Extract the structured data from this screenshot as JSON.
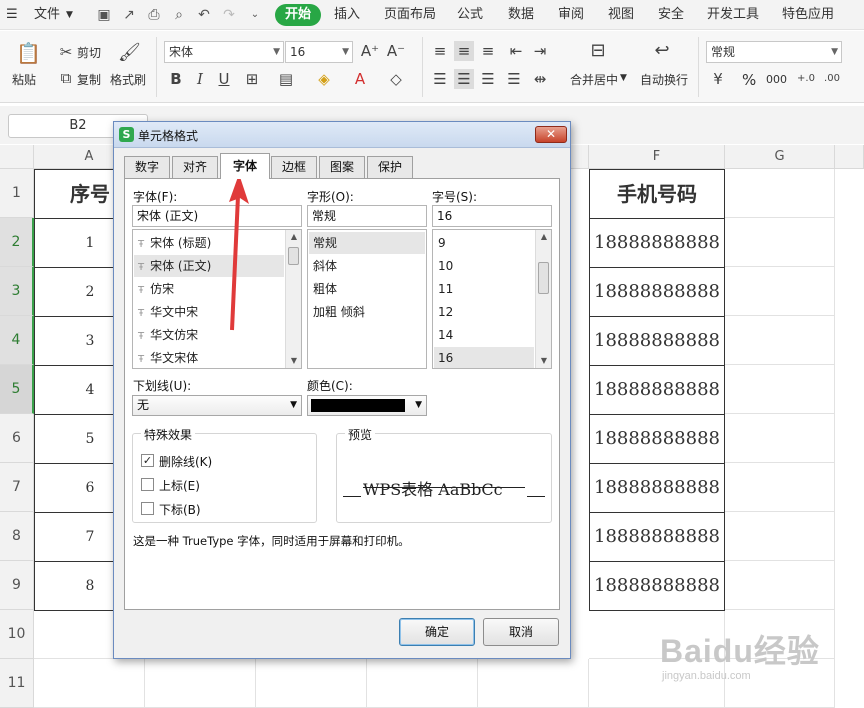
{
  "menu": {
    "file": "文件",
    "tabs": [
      "开始",
      "插入",
      "页面布局",
      "公式",
      "数据",
      "审阅",
      "视图",
      "安全",
      "开发工具",
      "特色应用"
    ]
  },
  "ribbon": {
    "paste": "粘贴",
    "cut": "剪切",
    "copy": "复制",
    "format_painter": "格式刷",
    "font_name": "宋体",
    "font_size": "16",
    "merge_center": "合并居中",
    "wrap_text": "自动换行",
    "number_format": "常规",
    "percent": "%",
    "comma": "000"
  },
  "formula_bar": {
    "cell_ref": "B2"
  },
  "sheet": {
    "columns": [
      "A",
      "F",
      "G"
    ],
    "rows": [
      "1",
      "2",
      "3",
      "4",
      "5",
      "6",
      "7",
      "8",
      "9",
      "10",
      "11"
    ],
    "header_a": "序号",
    "header_f": "手机号码",
    "seq": [
      "1",
      "2",
      "3",
      "4",
      "5",
      "6",
      "7",
      "8"
    ],
    "phones": [
      "18888888888",
      "18888888888",
      "18888888888",
      "18888888888",
      "18888888888",
      "18888888888",
      "18888888888",
      "18888888888"
    ]
  },
  "dialog": {
    "title": "单元格格式",
    "tabs": [
      "数字",
      "对齐",
      "字体",
      "边框",
      "图案",
      "保护"
    ],
    "font_label": "字体(F):",
    "font_value": "宋体 (正文)",
    "font_list": [
      "宋体 (标题)",
      "宋体 (正文)",
      "仿宋",
      "华文中宋",
      "华文仿宋",
      "华文宋体"
    ],
    "style_label": "字形(O):",
    "style_value": "常规",
    "style_list": [
      "常规",
      "斜体",
      "粗体",
      "加粗 倾斜"
    ],
    "size_label": "字号(S):",
    "size_value": "16",
    "size_list": [
      "9",
      "10",
      "11",
      "12",
      "14",
      "16"
    ],
    "underline_label": "下划线(U):",
    "underline_value": "无",
    "color_label": "颜色(C):",
    "color_value": "#000000",
    "effects_label": "特殊效果",
    "strikethrough": "删除线(K)",
    "superscript": "上标(E)",
    "subscript": "下标(B)",
    "preview_label": "预览",
    "preview_text": "WPS表格  AaBbCc",
    "note": "这是一种 TrueType 字体，同时适用于屏幕和打印机。",
    "ok": "确定",
    "cancel": "取消"
  },
  "watermark": {
    "brand": "Baidu经验",
    "sub": "jingyan.baidu.com"
  },
  "colors": {
    "accent": "#28a745",
    "arrow": "#e03a3a"
  }
}
